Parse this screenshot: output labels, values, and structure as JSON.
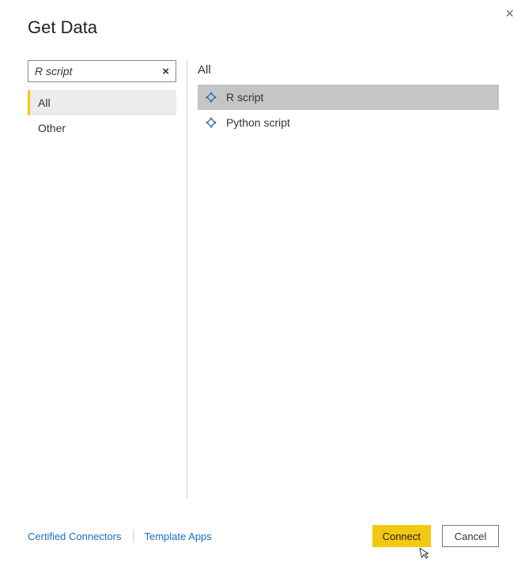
{
  "title": "Get Data",
  "close_glyph": "×",
  "search": {
    "value": "R script",
    "clear_glyph": "×"
  },
  "categories": [
    {
      "label": "All",
      "selected": true
    },
    {
      "label": "Other",
      "selected": false
    }
  ],
  "right_header": "All",
  "connectors": [
    {
      "label": "R script",
      "selected": true
    },
    {
      "label": "Python script",
      "selected": false
    }
  ],
  "links": {
    "certified": "Certified Connectors",
    "templates": "Template Apps"
  },
  "buttons": {
    "connect": "Connect",
    "cancel": "Cancel"
  },
  "colors": {
    "accent": "#f2c811",
    "link": "#1b6ec2",
    "selected_row": "#c5c5c5",
    "sidebar_selected": "#ececec"
  }
}
